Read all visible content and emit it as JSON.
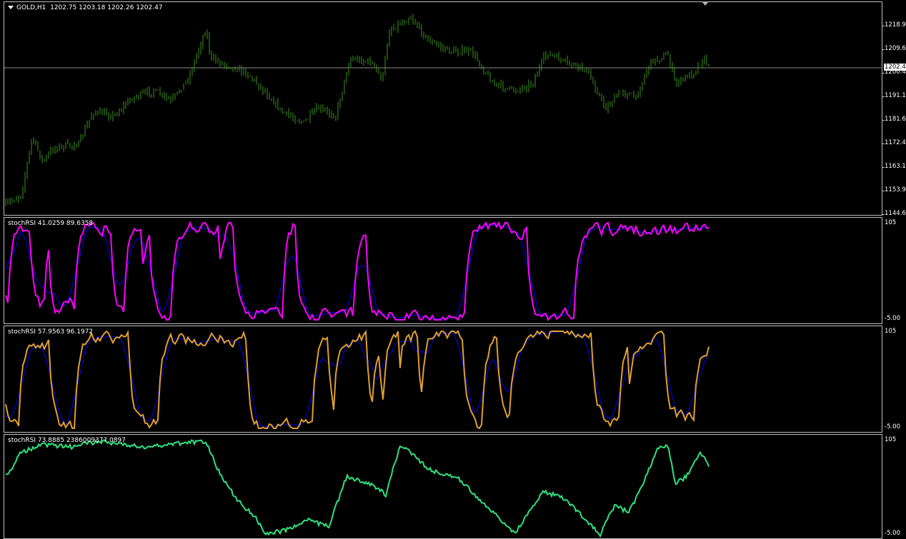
{
  "main_chart": {
    "symbol_label": "GOLD,H1",
    "ohlc": "1202.75 1203.18 1202.26 1202.47",
    "price_ticks": [
      "1218.90",
      "1209.65",
      "1200.40",
      "1191.15",
      "1181.65",
      "1172.40",
      "1163.15",
      "1153.90",
      "1144.65"
    ],
    "current_price": "1202.47",
    "bar_color": "#3f8f1f"
  },
  "indicators": [
    {
      "label": "stochRSI 41.0259 89.6358",
      "scale_top": "105",
      "scale_bottom": "-5.00",
      "main_color": "#ff00ff",
      "signal_color": "#0000ff"
    },
    {
      "label": "stochRSI 57.9563 96.1972",
      "scale_top": "105",
      "scale_bottom": "-5.00",
      "main_color": "#e0a030",
      "signal_color": "#0000ff"
    },
    {
      "label": "stochRSI 73.8885 2386009377.0897",
      "scale_top": "105",
      "scale_bottom": "-5.00",
      "main_color": "#30e080"
    }
  ]
}
